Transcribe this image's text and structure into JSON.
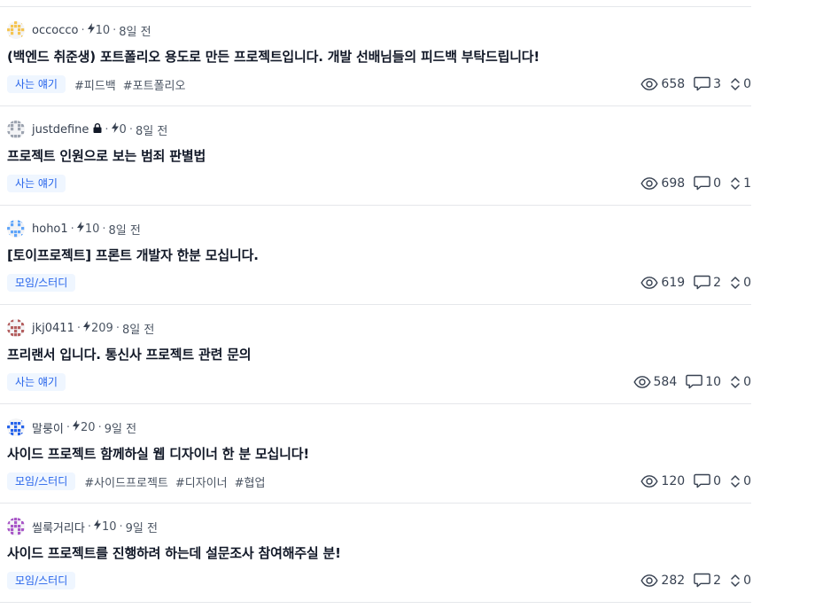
{
  "posts": [
    {
      "username": "occocco",
      "locked": false,
      "points": "10",
      "time": "8일 전",
      "title": "(백엔드 취준생) 포트폴리오 용도로 만든 프로젝트입니다. 개발 선배님들의 피드백 부탁드립니다!",
      "category": "사는 얘기",
      "tags": [
        "#피드백",
        "#포트폴리오"
      ],
      "views": "658",
      "comments": "3",
      "votes": "0",
      "avatar_color": "#f5c451"
    },
    {
      "username": "justdefine",
      "locked": true,
      "points": "0",
      "time": "8일 전",
      "title": "프로젝트 인원으로 보는 범죄 판별법",
      "category": "사는 얘기",
      "tags": [],
      "views": "698",
      "comments": "0",
      "votes": "1",
      "avatar_color": "#9ca3af"
    },
    {
      "username": "hoho1",
      "locked": false,
      "points": "10",
      "time": "8일 전",
      "title": "[토이프로젝트] 프론트 개발자 한분 모십니다.",
      "category": "모임/스터디",
      "tags": [],
      "views": "619",
      "comments": "2",
      "votes": "0",
      "avatar_color": "#60a5fa"
    },
    {
      "username": "jkj0411",
      "locked": false,
      "points": "209",
      "time": "8일 전",
      "title": "프리랜서 입니다. 통신사 프로젝트 관련 문의",
      "category": "사는 얘기",
      "tags": [],
      "views": "584",
      "comments": "10",
      "votes": "0",
      "avatar_color": "#b45f5f"
    },
    {
      "username": "말룽이",
      "locked": false,
      "points": "20",
      "time": "9일 전",
      "title": "사이드 프로젝트 함께하실 웹 디자이너 한 분 모십니다!",
      "category": "모임/스터디",
      "tags": [
        "#사이드프로젝트",
        "#디자이너",
        "#협업"
      ],
      "views": "120",
      "comments": "0",
      "votes": "0",
      "avatar_color": "#2563eb"
    },
    {
      "username": "씰룩거리다",
      "locked": false,
      "points": "10",
      "time": "9일 전",
      "title": "사이드 프로젝트를 진행하려 하는데 설문조사 참여해주실 분!",
      "category": "모임/스터디",
      "tags": [],
      "views": "282",
      "comments": "2",
      "votes": "0",
      "avatar_color": "#a855c7"
    }
  ]
}
